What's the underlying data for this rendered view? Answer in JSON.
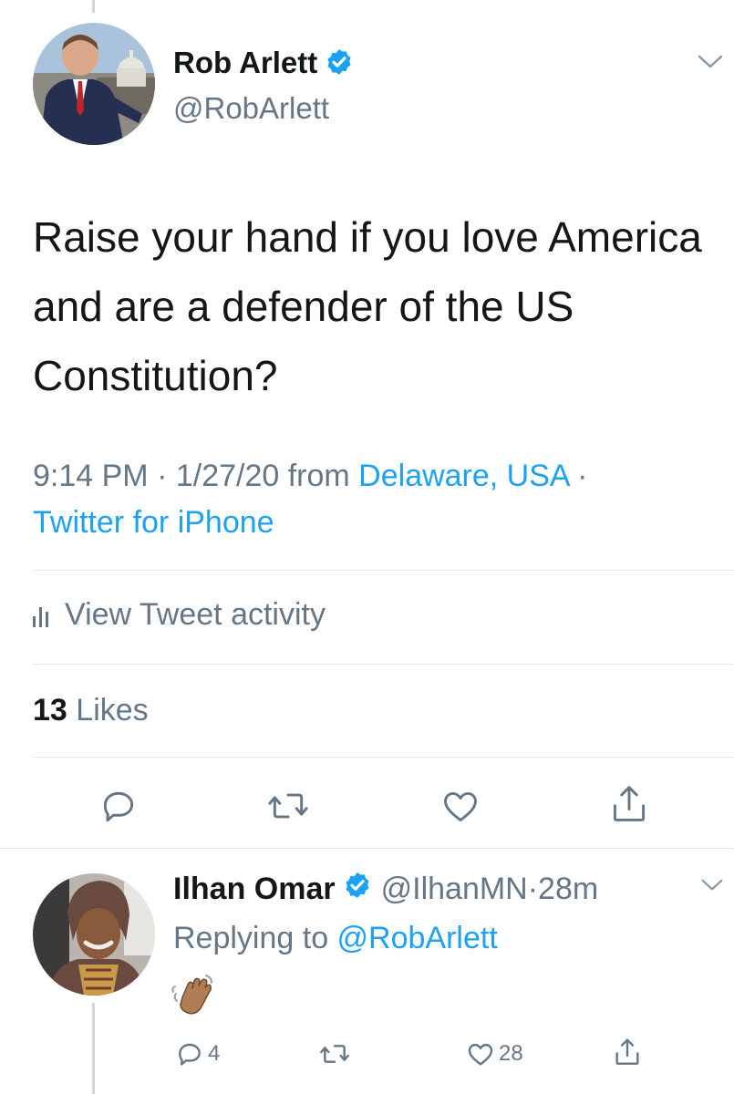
{
  "tweet": {
    "author_name": "Rob Arlett",
    "author_handle": "@RobArlett",
    "text": "Raise your hand if you love America and are a defender of the US Constitution?",
    "time": "9:14 PM · 1/27/20 from ",
    "location": "Delaware, USA",
    "separator": " ·",
    "source": "Twitter for iPhone",
    "activity_label": "View Tweet activity",
    "likes_count": "13",
    "likes_label": "Likes"
  },
  "reply": {
    "author_name": "Ilhan Omar",
    "author_handle": "@IlhanMN",
    "time": "·28m",
    "replying_prefix": "Replying to ",
    "replying_to": "@RobArlett",
    "emoji": "👋🏽",
    "reply_count": "4",
    "like_count": "28"
  },
  "icons": {
    "verified": "verified-badge-icon",
    "chevron": "chevron-down-icon",
    "reply": "reply-icon",
    "retweet": "retweet-icon",
    "like": "heart-icon",
    "share": "share-icon",
    "activity": "bar-chart-icon"
  },
  "colors": {
    "link": "#1da1f2",
    "secondary": "#657786",
    "primary": "#14171a",
    "divider": "#e1e8ed"
  }
}
